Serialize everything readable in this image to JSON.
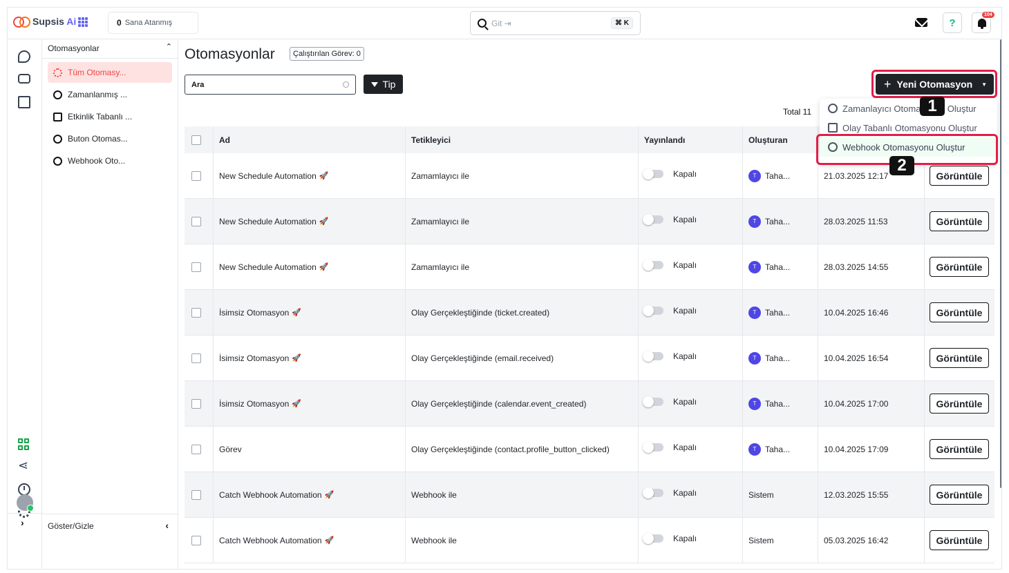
{
  "brand": {
    "name_left": "Supsis",
    "name_right": "Ai"
  },
  "header": {
    "assigned_count": "0",
    "assigned_label": "Sana Atanmış",
    "search_placeholder": "Git ⇥",
    "search_shortcut": "⌘ K",
    "help_label": "?",
    "notification_count": "104"
  },
  "sidebar": {
    "section_title": "Otomasyonlar",
    "items": [
      {
        "label": "Tüm Otomasy...",
        "icon": "gear-icon",
        "active": true
      },
      {
        "label": "Zamanlanmış ...",
        "icon": "history-icon"
      },
      {
        "label": "Etkinlik Tabanlı ...",
        "icon": "calendar-icon"
      },
      {
        "label": "Buton Otomas...",
        "icon": "pointer-icon"
      },
      {
        "label": "Webhook Oto...",
        "icon": "webhook-icon"
      }
    ],
    "footer_label": "Göster/Gizle"
  },
  "page": {
    "title": "Otomasyonlar",
    "run_count_label": "Çalıştırılan Görev: 0",
    "search_value": "Ara",
    "type_filter_label": "Tip",
    "new_button_label": "Yeni Otomasyon",
    "total_label": "Total 11"
  },
  "dropdown": {
    "items": [
      {
        "label": "Zamanlayıcı Otomasyonu Oluştur",
        "icon": "timer-icon"
      },
      {
        "label": "Olay Tabanlı Otomasyonu Oluştur",
        "icon": "calendar-icon"
      },
      {
        "label": "Webhook Otomasyonu Oluştur",
        "icon": "webhook-icon"
      }
    ]
  },
  "annotations": {
    "step1": "1",
    "step2": "2"
  },
  "table": {
    "headers": {
      "name": "Ad",
      "trigger": "Tetikleyici",
      "published": "Yayınlandı",
      "creator": "Oluşturan"
    },
    "view_label": "Görüntüle",
    "rows": [
      {
        "name": "New Schedule Automation",
        "rocket": "🚀",
        "trigger": "Zamamlayıcı ile",
        "status": "Kapalı",
        "avatar": "T",
        "creator": "Taha...",
        "date": "21.03.2025 12:17"
      },
      {
        "name": "New Schedule Automation",
        "rocket": "🚀",
        "trigger": "Zamamlayıcı ile",
        "status": "Kapalı",
        "avatar": "T",
        "creator": "Taha...",
        "date": "28.03.2025 11:53"
      },
      {
        "name": "New Schedule Automation",
        "rocket": "🚀",
        "trigger": "Zamamlayıcı ile",
        "status": "Kapalı",
        "avatar": "T",
        "creator": "Taha...",
        "date": "28.03.2025 14:55"
      },
      {
        "name": "İsimsiz Otomasyon",
        "rocket": "🚀",
        "trigger": "Olay Gerçekleştiğinde (ticket.created)",
        "status": "Kapalı",
        "avatar": "T",
        "creator": "Taha...",
        "date": "10.04.2025 16:46"
      },
      {
        "name": "İsimsiz Otomasyon",
        "rocket": "🚀",
        "trigger": "Olay Gerçekleştiğinde (email.received)",
        "status": "Kapalı",
        "avatar": "T",
        "creator": "Taha...",
        "date": "10.04.2025 16:54"
      },
      {
        "name": "İsimsiz Otomasyon",
        "rocket": "🚀",
        "trigger": "Olay Gerçekleştiğinde (calendar.event_created)",
        "status": "Kapalı",
        "avatar": "T",
        "creator": "Taha...",
        "date": "10.04.2025 17:00"
      },
      {
        "name": "Görev",
        "rocket": "",
        "trigger": "Olay Gerçekleştiğinde (contact.profile_button_clicked)",
        "status": "Kapalı",
        "avatar": "T",
        "creator": "Taha...",
        "date": "10.04.2025 17:09"
      },
      {
        "name": "Catch Webhook Automation",
        "rocket": "🚀",
        "trigger": "Webhook ile",
        "status": "Kapalı",
        "avatar": "",
        "creator": "Sistem",
        "date": "12.03.2025 15:55"
      },
      {
        "name": "Catch Webhook Automation",
        "rocket": "🚀",
        "trigger": "Webhook ile",
        "status": "Kapalı",
        "avatar": "",
        "creator": "Sistem",
        "date": "05.03.2025 16:42"
      }
    ]
  },
  "colors": {
    "accent": "#ef4444",
    "dark_button": "#1f2328",
    "highlight": "#e11d48",
    "avatar": "#4f46e5"
  }
}
